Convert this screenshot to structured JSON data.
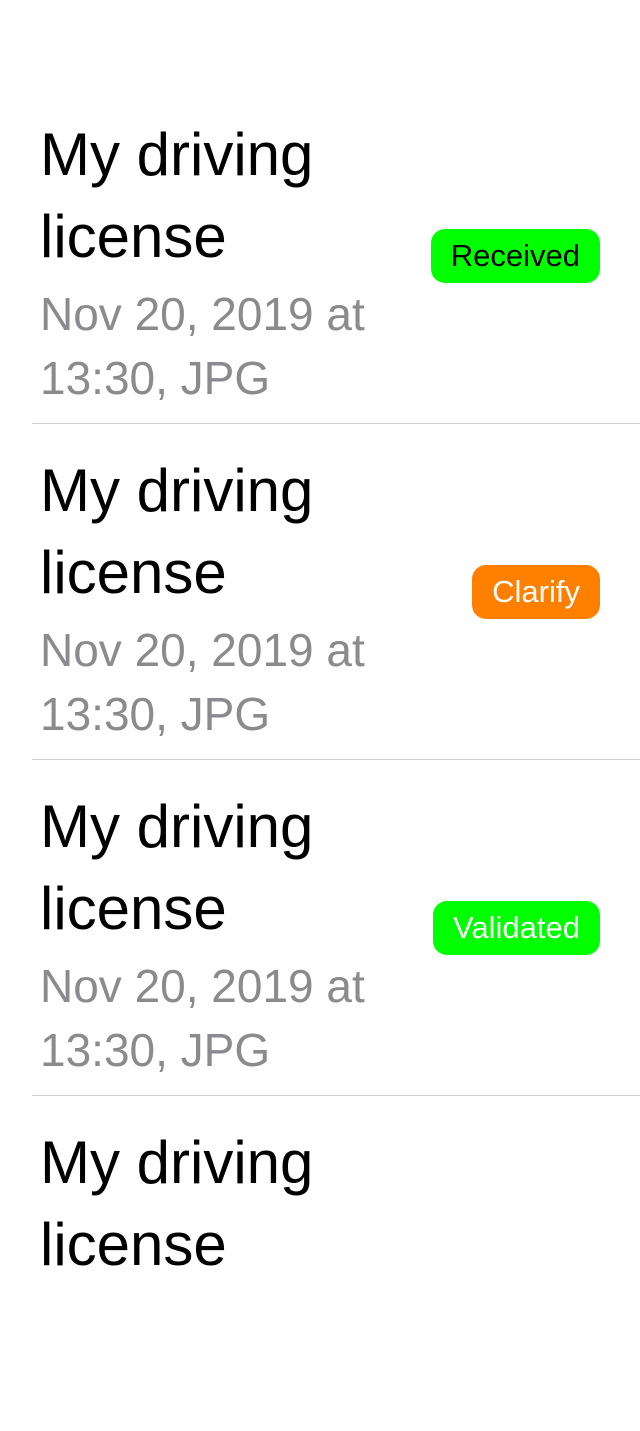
{
  "documents": [
    {
      "title": "My driving license",
      "subtitle": "Nov 20, 2019 at 13:30, JPG",
      "status": "Received",
      "status_bg": "#00ff00",
      "status_fg": "#000000"
    },
    {
      "title": "My driving license",
      "subtitle": "Nov 20, 2019 at 13:30, JPG",
      "status": "Clarify",
      "status_bg": "#ff7f00",
      "status_fg": "#ffffff"
    },
    {
      "title": "My driving license",
      "subtitle": "Nov 20, 2019 at 13:30, JPG",
      "status": "Validated",
      "status_bg": "#00ff00",
      "status_fg": "#ffffff"
    },
    {
      "title": "My driving license"
    }
  ]
}
